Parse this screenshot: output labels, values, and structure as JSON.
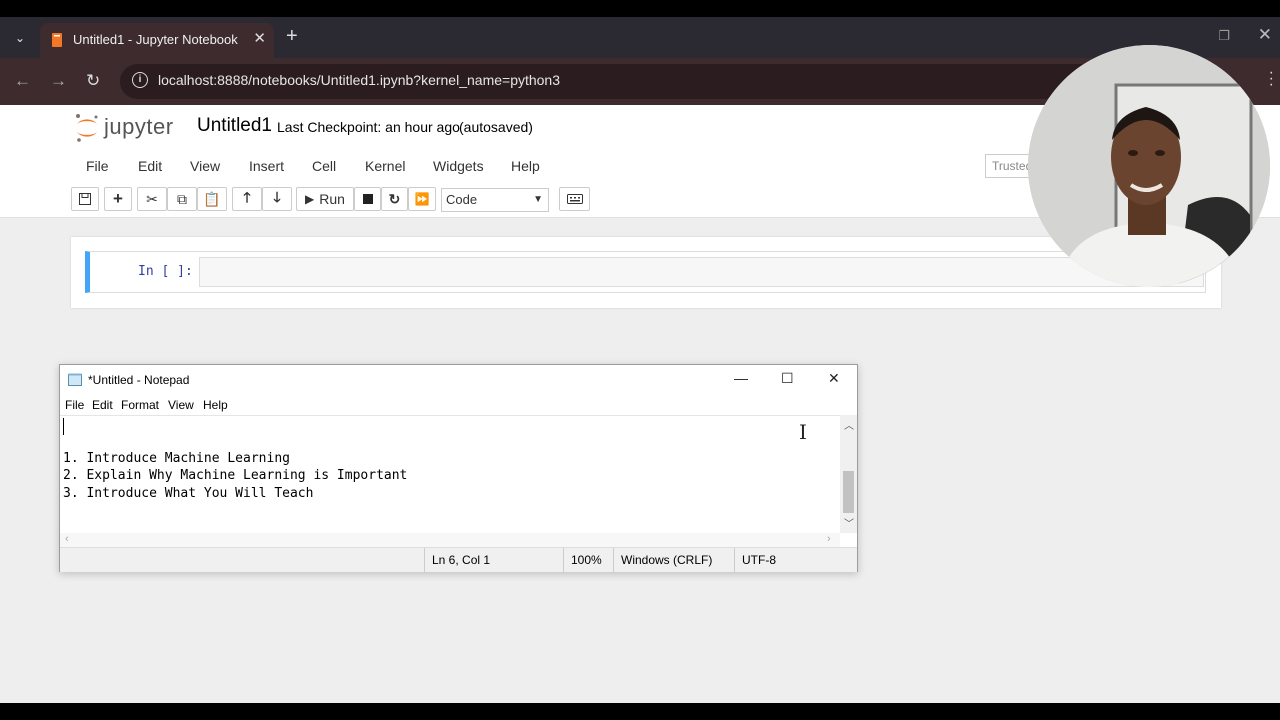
{
  "browser": {
    "tab_title": "Untitled1 - Jupyter Notebook",
    "url": "localhost:8888/notebooks/Untitled1.ipynb?kernel_name=python3"
  },
  "jupyter": {
    "logo_text": "jupyter",
    "notebook_name": "Untitled1",
    "checkpoint": "Last Checkpoint: an hour ago",
    "autosave_status": "(autosaved)",
    "menu": [
      "File",
      "Edit",
      "View",
      "Insert",
      "Cell",
      "Kernel",
      "Widgets",
      "Help"
    ],
    "trusted_label": "Trusted",
    "run_label": "Run",
    "cell_type": "Code",
    "cell_prompt": "In [ ]:"
  },
  "notepad": {
    "title": "*Untitled - Notepad",
    "menu": [
      "File",
      "Edit",
      "Format",
      "View",
      "Help"
    ],
    "lines": [
      "1. Introduce Machine Learning",
      "2. Explain Why Machine Learning is Important",
      "3. Introduce What You Will Teach"
    ],
    "status": {
      "position": "Ln 6, Col 1",
      "zoom": "100%",
      "line_endings": "Windows (CRLF)",
      "encoding": "UTF-8"
    }
  },
  "colors": {
    "browser_tab": "#3d2b2e",
    "jupyter_orange": "#f37726",
    "cell_selected": "#42a5f5"
  }
}
